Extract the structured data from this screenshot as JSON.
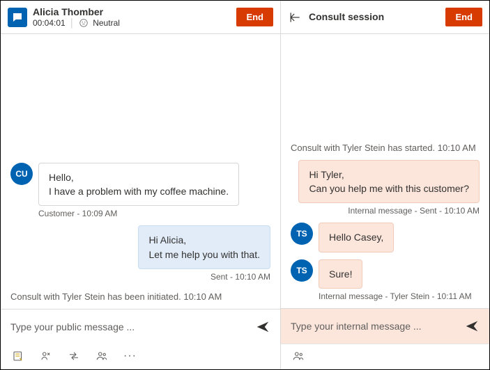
{
  "left": {
    "header": {
      "name": "Alicia Thomber",
      "timer": "00:04:01",
      "sentiment": "Neutral",
      "end": "End"
    },
    "messages": {
      "m1_line1": "Hello,",
      "m1_line2": "I have a problem with my coffee machine.",
      "m1_meta": "Customer - 10:09 AM",
      "m1_avatar": "CU",
      "m2_line1": "Hi Alicia,",
      "m2_line2": "Let me help you with that.",
      "m2_meta": "Sent - 10:10 AM",
      "sys1": "Consult with Tyler Stein has been initiated. 10:10 AM"
    },
    "composer_placeholder": "Type your public message ..."
  },
  "right": {
    "header": {
      "title": "Consult session",
      "end": "End"
    },
    "messages": {
      "sys1": "Consult with Tyler Stein has started. 10:10 AM",
      "m1_line1": "Hi Tyler,",
      "m1_line2": "Can you help me with this customer?",
      "m1_meta": "Internal message - Sent - 10:10 AM",
      "m2_text": "Hello Casey,",
      "m2_avatar": "TS",
      "m3_text": "Sure!",
      "m3_avatar": "TS",
      "m3_meta": "Internal message - Tyler Stein - 10:11 AM"
    },
    "composer_placeholder": "Type your internal message ..."
  }
}
